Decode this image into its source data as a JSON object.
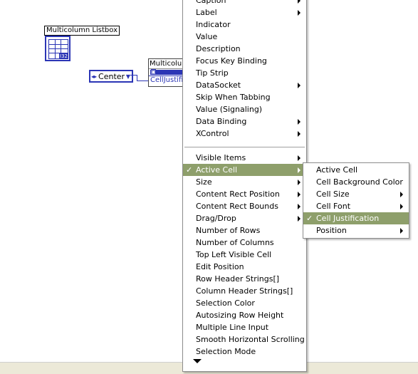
{
  "diagram": {
    "listbox_label": "Multicolumn Listbox",
    "listbox_tag": "I32",
    "enum_value": "Center",
    "property_node_title": "Multicolumn",
    "property_node_ref": "",
    "property_node_row": "CellJustifi"
  },
  "main_menu": {
    "items": [
      {
        "label": "Caption",
        "submenu": true
      },
      {
        "label": "Label",
        "submenu": true
      },
      {
        "label": "Indicator",
        "submenu": false
      },
      {
        "label": "Value",
        "submenu": false
      },
      {
        "label": "Description",
        "submenu": false
      },
      {
        "label": "Focus Key Binding",
        "submenu": false
      },
      {
        "label": "Tip Strip",
        "submenu": false
      },
      {
        "label": "DataSocket",
        "submenu": true
      },
      {
        "label": "Skip When Tabbing",
        "submenu": false
      },
      {
        "label": "Value (Signaling)",
        "submenu": false
      },
      {
        "label": "Data Binding",
        "submenu": true
      },
      {
        "label": "XControl",
        "submenu": true
      },
      {
        "label": "Visible Items",
        "submenu": true
      },
      {
        "label": "Active Cell",
        "submenu": true,
        "checked": true,
        "active": true
      },
      {
        "label": "Size",
        "submenu": true
      },
      {
        "label": "Content Rect Position",
        "submenu": true
      },
      {
        "label": "Content Rect Bounds",
        "submenu": true
      },
      {
        "label": "Drag/Drop",
        "submenu": true
      },
      {
        "label": "Number of Rows",
        "submenu": false
      },
      {
        "label": "Number of Columns",
        "submenu": false
      },
      {
        "label": "Top Left Visible Cell",
        "submenu": false
      },
      {
        "label": "Edit Position",
        "submenu": false
      },
      {
        "label": "Row Header Strings[]",
        "submenu": false
      },
      {
        "label": "Column Header Strings[]",
        "submenu": false
      },
      {
        "label": "Selection Color",
        "submenu": false
      },
      {
        "label": "Autosizing Row Height",
        "submenu": false
      },
      {
        "label": "Multiple Line Input",
        "submenu": false
      },
      {
        "label": "Smooth Horizontal Scrolling",
        "submenu": false
      },
      {
        "label": "Selection Mode",
        "submenu": false
      }
    ]
  },
  "sub_menu": {
    "items": [
      {
        "label": "Active Cell",
        "submenu": false
      },
      {
        "label": "Cell Background Color",
        "submenu": false
      },
      {
        "label": "Cell Size",
        "submenu": true
      },
      {
        "label": "Cell Font",
        "submenu": true
      },
      {
        "label": "Cell Justification",
        "submenu": false,
        "checked": true,
        "active": true
      },
      {
        "label": "Position",
        "submenu": true
      }
    ]
  },
  "check_glyph": "✓",
  "colors": {
    "highlight": "#8e9f6b",
    "wire": "#2b35b5"
  }
}
